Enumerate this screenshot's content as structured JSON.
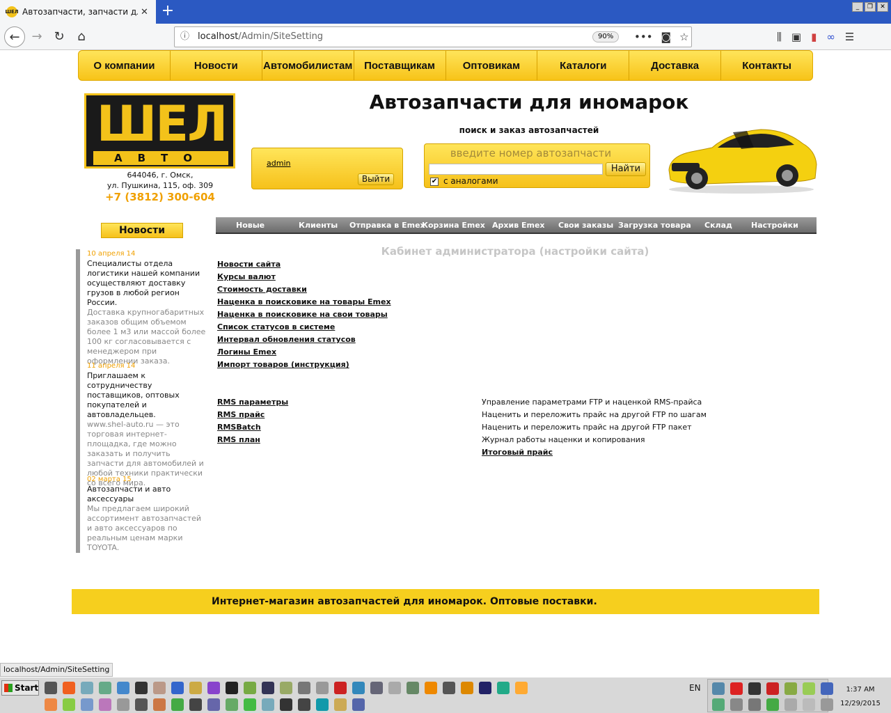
{
  "browser": {
    "tab_title": "Автозапчасти, запчасти для ино",
    "favicon_text": "ШЕЛ",
    "url_host": "localhost",
    "url_path": "/Admin/SiteSetting",
    "zoom": "90%",
    "status_url": "localhost/Admin/SiteSetting"
  },
  "top_menu": [
    "О компании",
    "Новости",
    "Автомобилистам",
    "Поставщикам",
    "Оптовикам",
    "Каталоги",
    "Доставка",
    "Контакты"
  ],
  "logo": {
    "big": "ШЕЛ",
    "small": "АВТО"
  },
  "address": {
    "line1": "644046, г. Омск,",
    "line2": "ул. Пушкина, 115, оф. 309"
  },
  "phone": "+7 (3812) 300-604",
  "site_title": "Автозапчасти для иномарок",
  "subtitle": "поиск и заказ автозапчастей",
  "login": {
    "user": "admin",
    "logout": "Выйти"
  },
  "search": {
    "placeholder": "введите номер автозапчасти",
    "button": "Найти",
    "checkbox_label": "с аналогами",
    "checked": true
  },
  "news": {
    "button": "Новости",
    "items": [
      {
        "date": "10 апреля 14",
        "head": "Специалисты отдела логистики нашей компании осуществляют доставку грузов в любой регион России.",
        "body": "Доставка крупногабаритных заказов общим объемом более 1 м3 или массой более 100 кг согласовывается с менеджером при оформлении заказа."
      },
      {
        "date": "11 апреля 14",
        "head": "Приглашаем к сотрудничеству поставщиков, оптовых покупателей и автовладельцев.",
        "body": "www.shel-auto.ru — это торговая интернет-площадка, где можно заказать и получить запчасти для автомобилей и любой техники практически со всего мира."
      },
      {
        "date": "02 марта 15",
        "head": "Автозапчасти и авто аксессуары",
        "body": "Мы предлагаем широкий ассортимент автозапчастей и авто аксессуаров по реальным ценам марки TOYOTA."
      }
    ]
  },
  "admin_nav": [
    "Новые",
    "Клиенты",
    "Отправка в Emex",
    "Корзина Emex",
    "Архив Emex",
    "Свои заказы",
    "Загрузка товара",
    "Склад",
    "Настройки сайта"
  ],
  "cabinet_title": "Кабинет администратора (настройки сайта)",
  "settings_links": [
    "Новости сайта",
    "Курсы валют",
    "Стоимость доставки",
    "Наценка в поисковике на товары Emex",
    "Наценка в поисковике на свои товары",
    "Список статусов в системе",
    "Интервал обновления статусов",
    "Логины Emex",
    "Импорт товаров (инструкция)"
  ],
  "rms_links": [
    "RMS параметры",
    "RMS прайс",
    "RMSBatch",
    "RMS план"
  ],
  "rms_descriptions": [
    "Управление параметрами FTP и наценкой RMS-прайса",
    "Наценить и переложить прайс на другой FTP по шагам",
    "Наценить и переложить прайс на другой FTP пакет",
    "Журнал работы наценки и копирования"
  ],
  "final_price_link": "Итоговый прайс",
  "footer_text": "Интернет-магазин автозапчастей для иномарок. Оптовые поставки.",
  "taskbar": {
    "start": "Start",
    "lang": "EN",
    "time": "1:37 AM",
    "date": "12/29/2015"
  },
  "colors": {
    "accent_yellow": "#f6c11a",
    "nav_gray": "#7a7a7a",
    "orange_text": "#f0a000"
  }
}
